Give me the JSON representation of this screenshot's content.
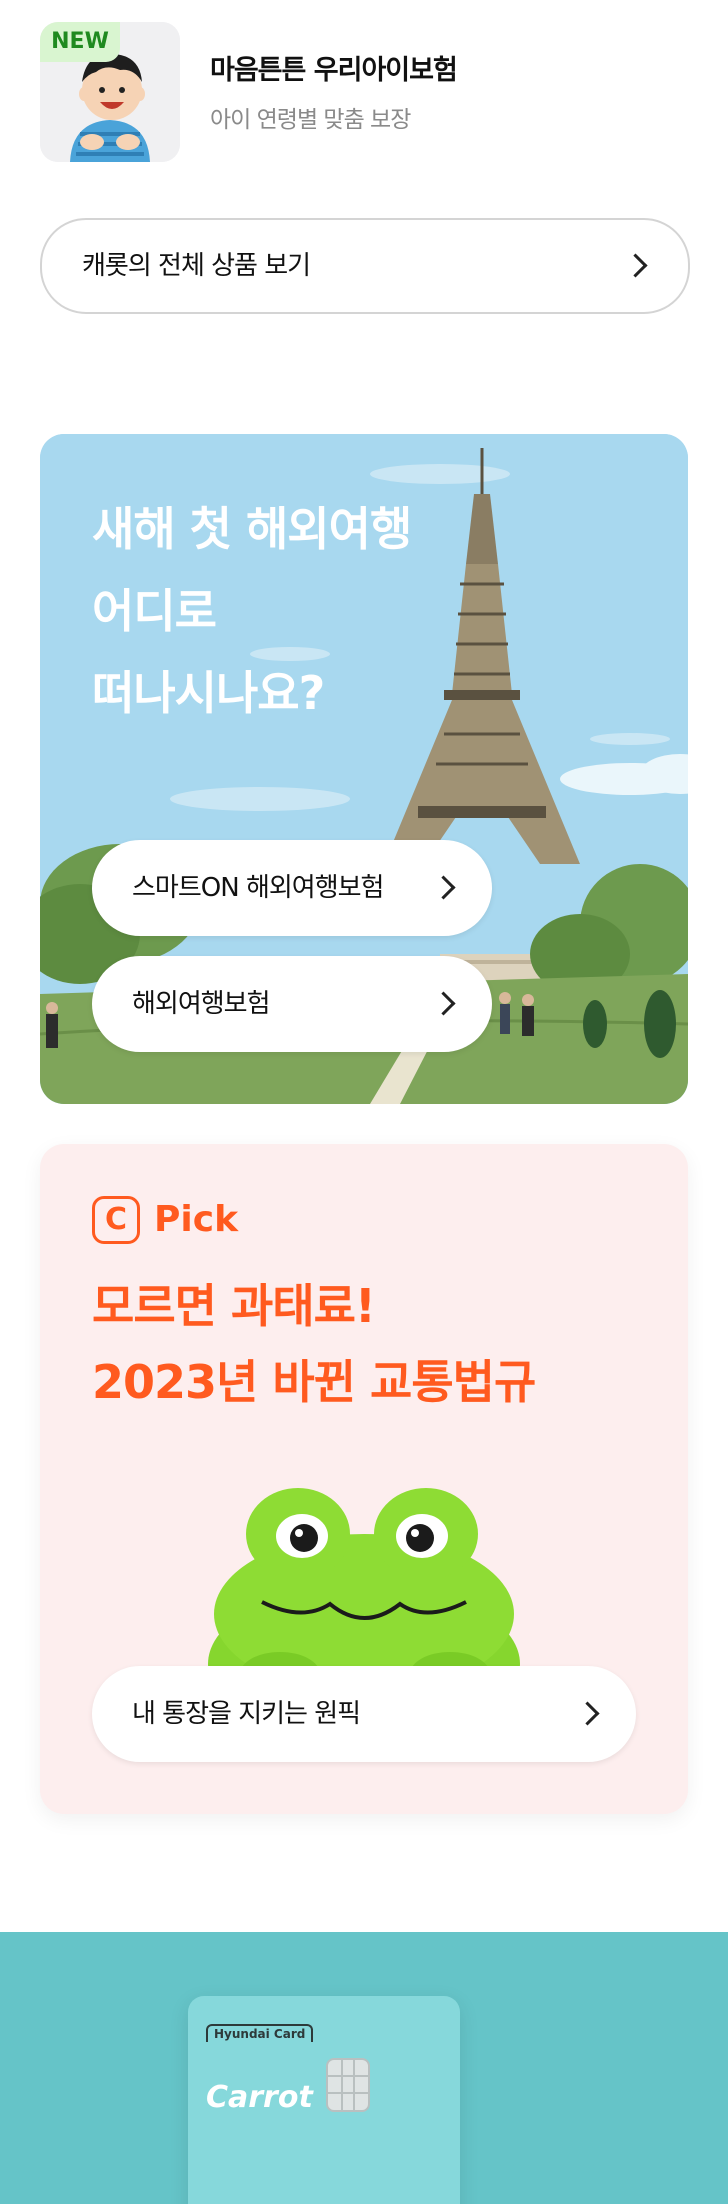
{
  "product": {
    "badge": "NEW",
    "title": "마음튼튼 우리아이보험",
    "subtitle": "아이 연령별 맞춤 보장"
  },
  "all_products": {
    "label": "캐롯의 전체 상품 보기"
  },
  "travel_card": {
    "title_lines": [
      "새해 첫 해외여행",
      "어디로",
      "떠나시나요?"
    ],
    "buttons": [
      "스마트ON 해외여행보험",
      "해외여행보험"
    ]
  },
  "pick_card": {
    "logo_letter": "C",
    "logo_word": "Pick",
    "title_lines": [
      "모르면 과태료!",
      "2023년 바뀐 교통법규"
    ],
    "button": "내 통장을 지키는 원픽"
  },
  "card_promo": {
    "brand": "Hyundai Card",
    "card_name": "Carrot"
  },
  "colors": {
    "accent": "#ff5a1f",
    "new_badge_bg": "#d9f5d0",
    "new_badge_text": "#1f8a1f",
    "sky": "#a8d8ef",
    "pick_bg": "#fdeeee",
    "card_section_bg": "#65c4c8"
  }
}
